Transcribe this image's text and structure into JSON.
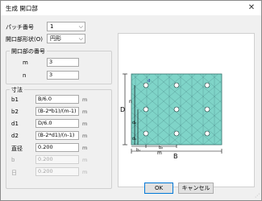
{
  "window": {
    "title": "生成 開口部",
    "close": "✕"
  },
  "patch_number": {
    "label": "パッチ番号",
    "value": "1"
  },
  "opening_shape": {
    "label": "開口部形状(O)",
    "value": "円形"
  },
  "opening_number": {
    "title": "開口部の番号",
    "m": {
      "label": "m",
      "value": "3"
    },
    "n": {
      "label": "n",
      "value": "3"
    }
  },
  "dimensions": {
    "title": "寸法",
    "rows": [
      {
        "label": "b1",
        "value": "B/6.0",
        "unit": "m",
        "disabled": false
      },
      {
        "label": "b2",
        "value": "(B-2*b1)/(m-1)",
        "unit": "m",
        "disabled": false
      },
      {
        "label": "d1",
        "value": "D/6.0",
        "unit": "m",
        "disabled": false
      },
      {
        "label": "d2",
        "value": "(B-2*d1)/(n-1)",
        "unit": "m",
        "disabled": false
      },
      {
        "label": "直径",
        "value": "0.200",
        "unit": "m",
        "disabled": false
      },
      {
        "label": "b",
        "value": "0.200",
        "unit": "m",
        "disabled": true
      },
      {
        "label": "日",
        "value": "0.200",
        "unit": "m",
        "disabled": true
      }
    ]
  },
  "diagram": {
    "labels": {
      "D": "D",
      "B": "B",
      "m": "m",
      "n": "n",
      "b1": "b₁",
      "b2": "b₂",
      "d1": "d₁",
      "d2": "d₂",
      "d": "d"
    },
    "colors": {
      "plate": "#7fd4c8",
      "hole": "#ffffff",
      "mesh": "#4a8a88",
      "dims": "#000000"
    }
  },
  "buttons": {
    "ok": "OK",
    "cancel": "キャンセル"
  }
}
